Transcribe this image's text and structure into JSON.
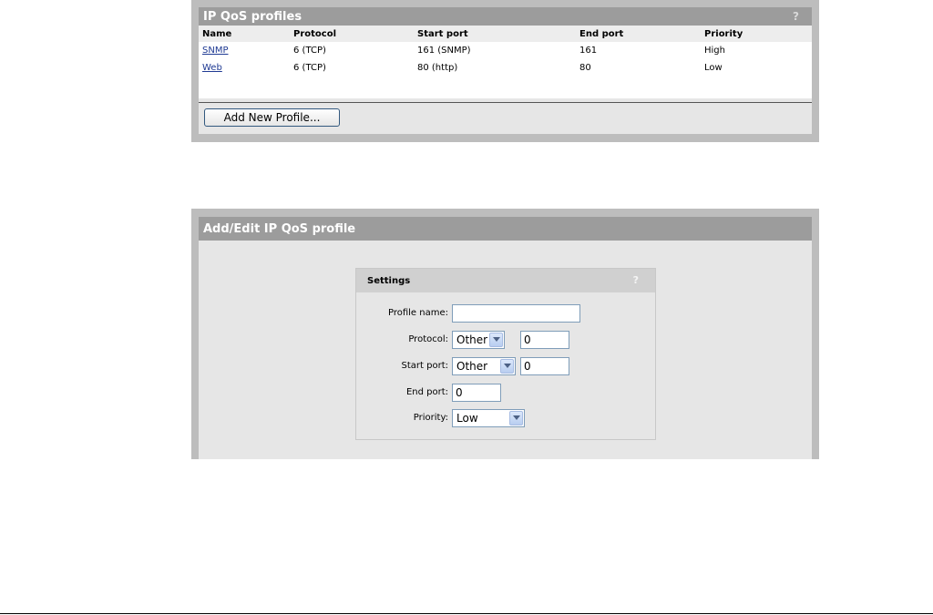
{
  "profiles_panel": {
    "title": "IP QoS profiles",
    "help": "?",
    "columns": [
      "Name",
      "Protocol",
      "Start port",
      "End port",
      "Priority"
    ],
    "rows": [
      {
        "name": "SNMP",
        "protocol": "6 (TCP)",
        "start_port": "161 (SNMP)",
        "end_port": "161",
        "priority": "High"
      },
      {
        "name": "Web",
        "protocol": "6 (TCP)",
        "start_port": "80 (http)",
        "end_port": "80",
        "priority": "Low"
      }
    ],
    "add_button": "Add New Profile..."
  },
  "edit_panel": {
    "title": "Add/Edit IP QoS profile",
    "settings": {
      "title": "Settings",
      "help": "?",
      "profile_name_label": "Profile name:",
      "profile_name_value": "",
      "protocol_label": "Protocol:",
      "protocol_selected": "Other",
      "protocol_value": "0",
      "start_port_label": "Start port:",
      "start_port_selected": "Other",
      "start_port_value": "0",
      "end_port_label": "End port:",
      "end_port_value": "0",
      "priority_label": "Priority:",
      "priority_selected": "Low"
    }
  }
}
